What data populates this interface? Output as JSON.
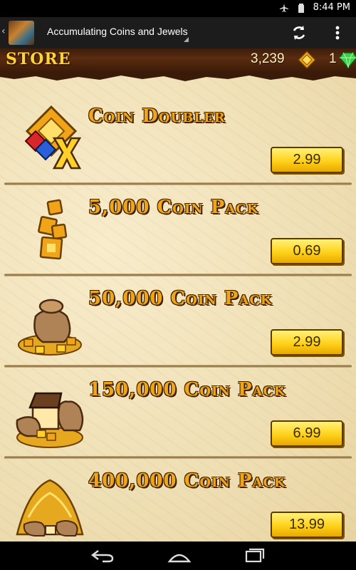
{
  "status_bar": {
    "time": "8:44 PM"
  },
  "action_bar": {
    "title": "Accumulating Coins and Jewels"
  },
  "store": {
    "title": "STORE",
    "coins": "3,239",
    "gems": "1",
    "items": [
      {
        "name": "Coin Doubler",
        "price": "2.99"
      },
      {
        "name": "5,000 Coin Pack",
        "price": "0.69"
      },
      {
        "name": "50,000 Coin Pack",
        "price": "2.99"
      },
      {
        "name": "150,000 Coin Pack",
        "price": "6.99"
      },
      {
        "name": "400,000 Coin Pack",
        "price": "13.99"
      }
    ]
  },
  "nav_bar": {
    "buttons": [
      "back",
      "home",
      "recent-apps"
    ]
  },
  "icons": {
    "gold": "#f0a418",
    "gem_green": "#3fcf4a",
    "ruby": "#d8262b",
    "sapphire": "#2a5fd8"
  }
}
